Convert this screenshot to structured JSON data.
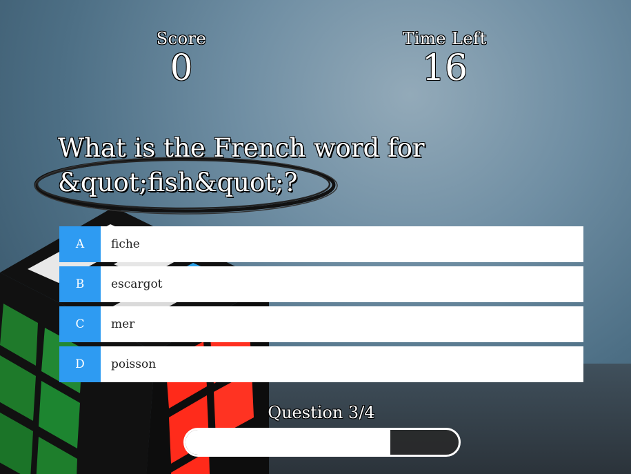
{
  "score": {
    "label": "Score",
    "value": "0"
  },
  "time": {
    "label": "Time Left",
    "value": "16"
  },
  "question": {
    "text": "What is the French word for &quot;fish&quot;?"
  },
  "answers": [
    {
      "letter": "A",
      "text": "fiche"
    },
    {
      "letter": "B",
      "text": "escargot"
    },
    {
      "letter": "C",
      "text": "mer"
    },
    {
      "letter": "D",
      "text": "poisson"
    }
  ],
  "progress": {
    "label": "Question 3/4",
    "fraction": 0.75
  },
  "colors": {
    "accent": "#2e9bf2",
    "text": "#ffffff"
  }
}
